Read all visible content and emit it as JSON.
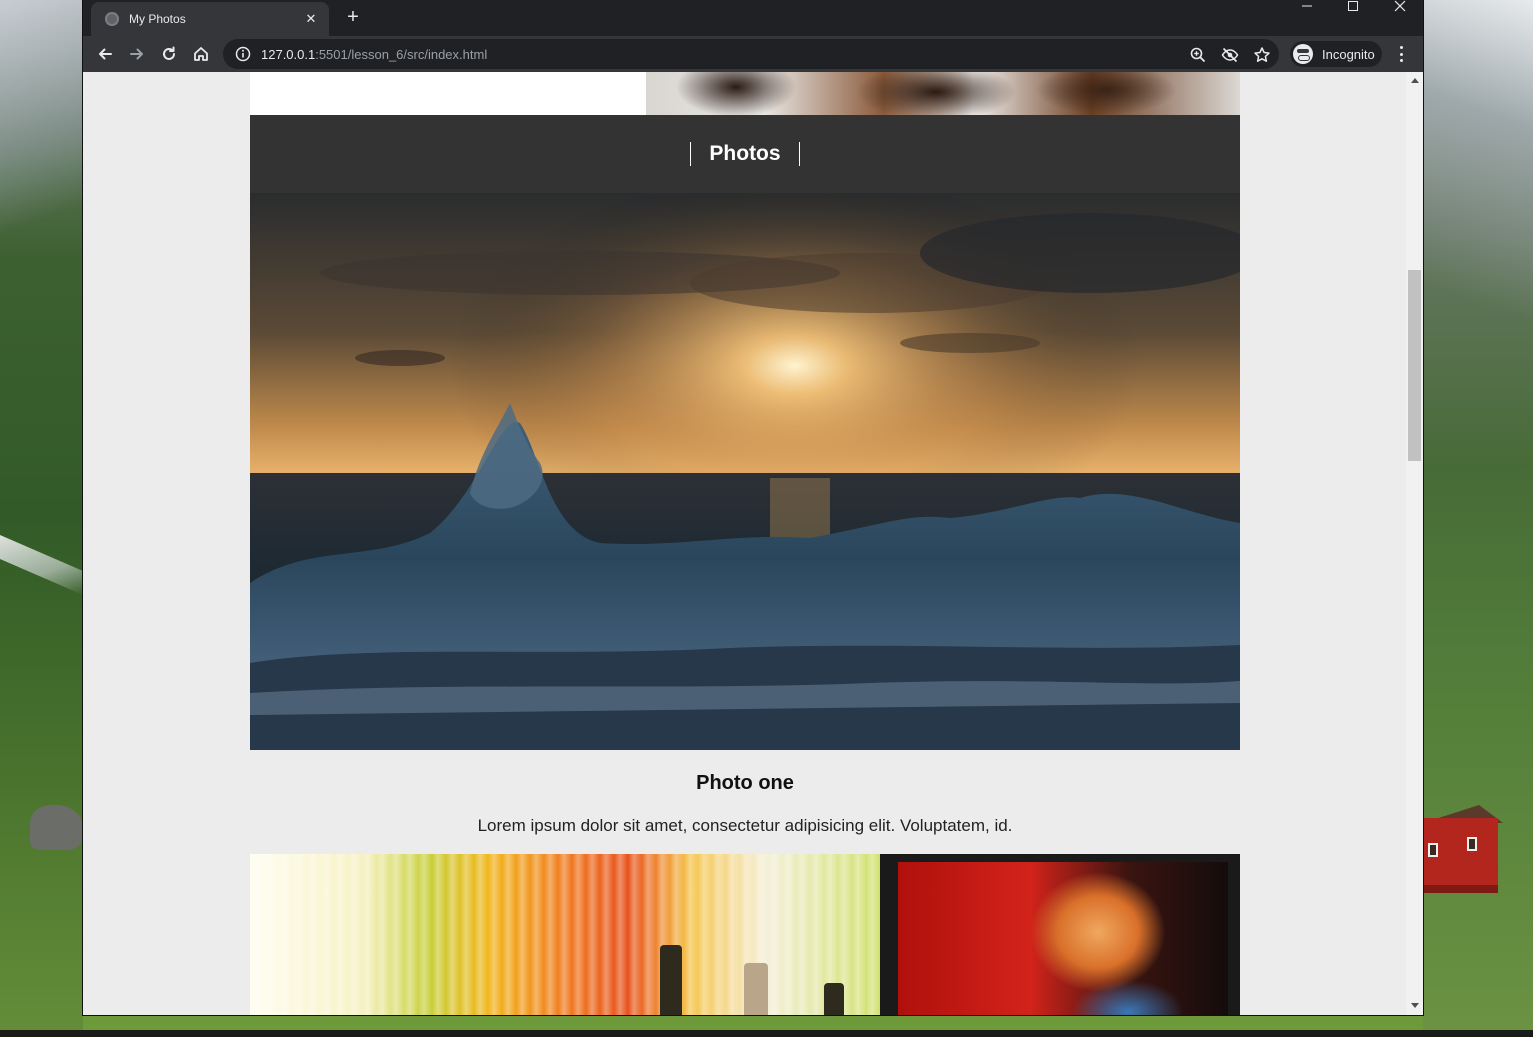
{
  "browser": {
    "tab": {
      "title": "My Photos"
    },
    "address": {
      "url_host": "127.0.0.1",
      "url_rest": ":5501/lesson_6/src/index.html"
    },
    "profile_label": "Incognito"
  },
  "page": {
    "section_title": "Photos",
    "photo": {
      "title": "Photo one",
      "description": "Lorem ipsum dolor sit amet, consectetur adipisicing elit. Voluptatem, id."
    }
  },
  "icons": {
    "favicon": "globe-icon",
    "tab_close": "close-icon",
    "new_tab": "plus-icon",
    "back": "arrow-left-icon",
    "forward": "arrow-right-icon",
    "reload": "reload-icon",
    "home": "home-icon",
    "site_info": "info-icon",
    "zoom": "zoom-icon",
    "tracking": "eye-slash-icon",
    "bookmark": "star-icon",
    "menu": "kebab-menu-icon"
  },
  "colors": {
    "browser_frame": "#202124",
    "toolbar": "#35363a",
    "page_background": "#ececec",
    "section_header": "#333333"
  }
}
